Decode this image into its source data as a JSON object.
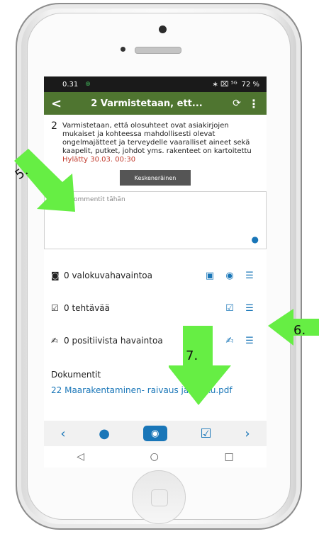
{
  "status": {
    "time": "0.31",
    "sim": "⊕",
    "icons": "∗ ⌧ ⁵ᴳ",
    "battery": "72 %"
  },
  "appbar": {
    "title": "2 Varmistetaan, ett...",
    "back": "<",
    "sync": "⟳",
    "more": "⋮"
  },
  "task": {
    "number": "2",
    "text": "Varmistetaan, että olosuhteet ovat asiakirjojen mukaiset ja kohteessa mahdollisesti olevat ongelmajätteet ja terveydelle vaaralliset aineet sekä kaapelit, putket, johdot yms. rakenteet on kartoitettu",
    "rejected": "Hylätty 30.03. 00:30"
  },
  "status_button": "Keskeneräinen",
  "comment": {
    "placeholder": "Lisää kommentit tähän"
  },
  "rows": [
    {
      "label": "0 valokuvahavaintoa"
    },
    {
      "label": "0 tehtävää"
    },
    {
      "label": "0 positiivista havaintoa"
    }
  ],
  "docs": {
    "heading": "Dokumentit",
    "link": "22 Maarakentaminen- raivaus ja purku.pdf"
  },
  "callouts": {
    "c5": "5.",
    "c6": "6.",
    "c7": "7."
  },
  "colors": {
    "appbar": "#4f7530",
    "accent": "#1976b8",
    "arrow": "#66ee44"
  }
}
